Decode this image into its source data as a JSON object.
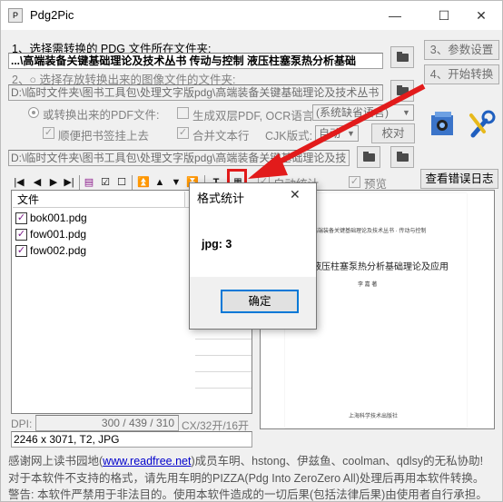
{
  "window": {
    "title": "Pdg2Pic",
    "minimize": "—",
    "maximize": "☐",
    "close": "✕"
  },
  "step1": {
    "label": "1、选择需转换的 PDG 文件所在文件夹:",
    "path": "...\\高端装备关键基础理论及技术丛书  传动与控制  液压柱塞泵热分析基础"
  },
  "step2": {
    "label": "2、○  选择存放转换出来的图像文件的文件夹:",
    "path": "D:\\临时文件夹\\图书工具包\\处理文字版pdg\\高端装备关键基础理论及技术丛书",
    "pdf_radio": "或转换出来的PDF文件:",
    "dual_layer": "生成双层PDF, OCR语言:",
    "ocr_lang": "(系统缺省语言)",
    "bookmark": "顺便把书签挂上去",
    "merge_lines": "合并文本行",
    "cjk_label": "CJK版式:",
    "cjk_value": "自动",
    "calibrate": "校对",
    "pdf_path": "D:\\临时文件夹\\图书工具包\\处理文字版pdg\\高端装备关键基础理论及技"
  },
  "right_buttons": {
    "settings": "3、参数设置",
    "start": "4、开始转换",
    "error_log": "查看错误日志"
  },
  "toolbar": {
    "auto_stat": "自动统计",
    "preview": "预览",
    "icons": [
      "first-icon",
      "prev-icon",
      "next-icon",
      "last-icon",
      "pdg-icon",
      "check-icon",
      "uncheck-icon",
      "top-icon",
      "up-icon",
      "down-icon",
      "bottom-icon",
      "t-icon",
      "stat-icon"
    ]
  },
  "filelist": {
    "header": "文件",
    "files": [
      "bok001.pdg",
      "fow001.pdg",
      "fow002.pdg"
    ]
  },
  "preview_page": {
    "series": "高端装备关键基础理论及技术丛书 · 传动与控制",
    "title": "液压柱塞泵热分析基础理论及应用",
    "author": "李 嘉 著",
    "publisher": "上海科学技术出版社"
  },
  "status": {
    "dpi_label": "DPI:",
    "dpi_value": "300 / 439 / 310",
    "format": "CX/32开/16开",
    "info": "2246 x 3071, T2, JPG"
  },
  "dialog": {
    "title": "格式统计",
    "body": "jpg: 3",
    "ok": "确定",
    "close": "✕"
  },
  "footer": {
    "line1_pre": "感谢网上读书园地(",
    "line1_link": "www.readfree.net",
    "line1_post": ")成员车明、hstong、伊兹鱼、coolman、qdlsy的无私协助!",
    "line2": "对于本软件不支持的格式，请先用车明的PIZZA(Pdg Into ZeroZero All)处理后再用本软件转换。",
    "line3": "警告: 本软件严禁用于非法目的。使用本软件造成的一切后果(包括法律后果)由使用者自行承担。"
  },
  "colors": {
    "arrow": "#e21b1b",
    "dialog_accent": "#0078d7",
    "link": "#0000cc"
  }
}
